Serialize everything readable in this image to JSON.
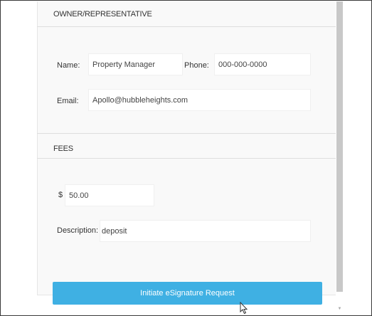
{
  "owner_section": {
    "title": "OWNER/REPRESENTATIVE",
    "name_label": "Name:",
    "name_value": "Property Manager",
    "phone_label": "Phone:",
    "phone_value": "000-000-0000",
    "email_label": "Email:",
    "email_value": "Apollo@hubbleheights.com"
  },
  "fees_section": {
    "title": "FEES",
    "currency_symbol": "$",
    "amount_value": "50.00",
    "description_label": "Description:",
    "description_value": "deposit"
  },
  "actions": {
    "initiate_label": "Initiate eSignature Request"
  },
  "colors": {
    "button_accent": "#3fb0e3",
    "panel_background": "#f9f9f9",
    "divider": "#dedede"
  },
  "icons": {
    "cursor": "mouse-pointer-icon",
    "scroll_down": "scroll-down-arrow-icon"
  }
}
